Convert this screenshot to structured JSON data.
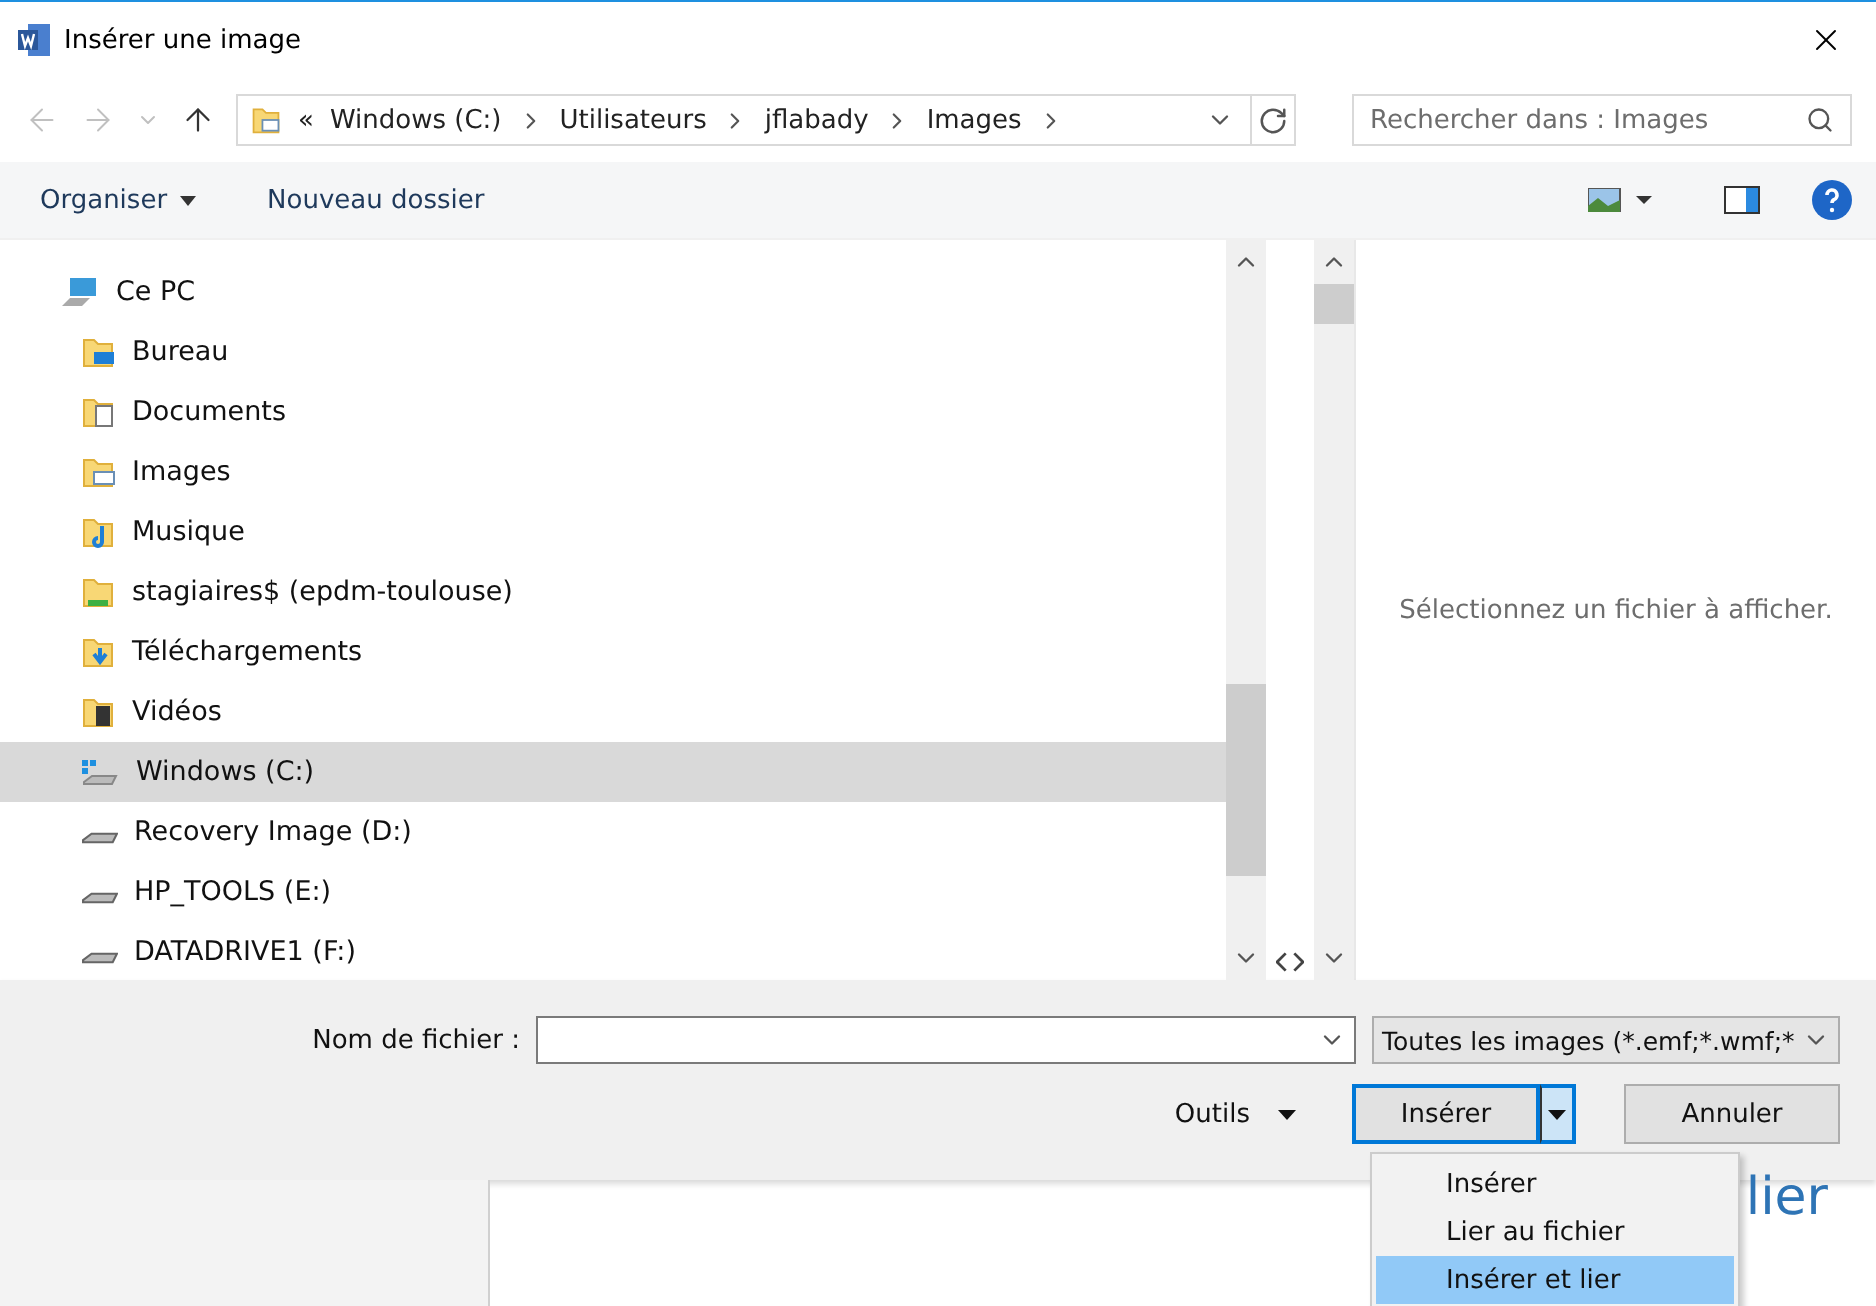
{
  "window": {
    "title": "Insérer une image"
  },
  "address": {
    "overflow": "«",
    "segments": [
      "Windows (C:)",
      "Utilisateurs",
      "jflabady",
      "Images"
    ]
  },
  "search": {
    "placeholder": "Rechercher dans : Images"
  },
  "toolbar": {
    "organize": "Organiser",
    "new_folder": "Nouveau dossier"
  },
  "tree": [
    {
      "label": "Ce PC",
      "kind": "computer",
      "selected": false,
      "children": [
        {
          "label": "Bureau",
          "kind": "desktop",
          "selected": false
        },
        {
          "label": "Documents",
          "kind": "documents",
          "selected": false
        },
        {
          "label": "Images",
          "kind": "pictures",
          "selected": false
        },
        {
          "label": "Musique",
          "kind": "music",
          "selected": false
        },
        {
          "label": "stagiaires$ (epdm-toulouse)",
          "kind": "network",
          "selected": false
        },
        {
          "label": "Téléchargements",
          "kind": "downloads",
          "selected": false
        },
        {
          "label": "Vidéos",
          "kind": "videos",
          "selected": false
        },
        {
          "label": "Windows (C:)",
          "kind": "system-drive",
          "selected": true
        },
        {
          "label": "Recovery Image (D:)",
          "kind": "drive",
          "selected": false
        },
        {
          "label": "HP_TOOLS (E:)",
          "kind": "drive",
          "selected": false
        },
        {
          "label": "DATADRIVE1 (F:)",
          "kind": "drive",
          "selected": false
        }
      ]
    }
  ],
  "preview": {
    "message": "Sélectionnez un fichier à afficher."
  },
  "footer": {
    "filename_label": "Nom de fichier :",
    "filter": "Toutes les images (*.emf;*.wmf;*",
    "tools": "Outils",
    "insert": "Insérer",
    "cancel": "Annuler"
  },
  "insert_menu": [
    {
      "label": "Insérer",
      "selected": false
    },
    {
      "label": "Lier au fichier",
      "selected": false
    },
    {
      "label": "Insérer et lier",
      "selected": true
    }
  ],
  "background_document": {
    "text": "lier"
  }
}
